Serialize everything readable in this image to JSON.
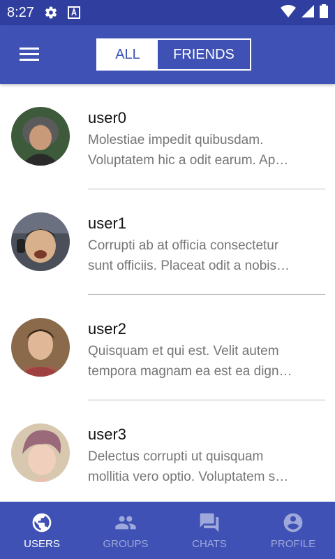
{
  "status_bar": {
    "time": "8:27",
    "icons": [
      "settings-icon",
      "font-badge-icon",
      "wifi-icon",
      "cell-signal-icon",
      "battery-icon"
    ]
  },
  "app_bar": {
    "menu_icon": "hamburger-menu-icon",
    "toggle": {
      "options": [
        "ALL",
        "FRIENDS"
      ],
      "selected": "ALL"
    }
  },
  "users": [
    {
      "name": "user0",
      "desc_line1": "Molestiae impedit quibusdam.",
      "desc_line2": "Voluptatem hic a odit earum. Ap…"
    },
    {
      "name": "user1",
      "desc_line1": "Corrupti ab at officia consectetur",
      "desc_line2": "sunt officiis. Placeat odit a nobis…"
    },
    {
      "name": "user2",
      "desc_line1": "Quisquam et qui est. Velit autem",
      "desc_line2": "tempora magnam ea est ea dign…"
    },
    {
      "name": "user3",
      "desc_line1": "Delectus corrupti ut quisquam",
      "desc_line2": "mollitia vero optio. Voluptatem s…"
    }
  ],
  "bottom_nav": {
    "tabs": [
      {
        "label": "USERS",
        "icon": "globe-icon",
        "active": true
      },
      {
        "label": "GROUPS",
        "icon": "group-icon",
        "active": false
      },
      {
        "label": "CHATS",
        "icon": "chat-icon",
        "active": false
      },
      {
        "label": "PROFILE",
        "icon": "account-circle-icon",
        "active": false
      }
    ]
  },
  "colors": {
    "primary": "#3F51B5",
    "primary_dark": "#303F9F",
    "inactive_tab": "#9FA8DA"
  }
}
